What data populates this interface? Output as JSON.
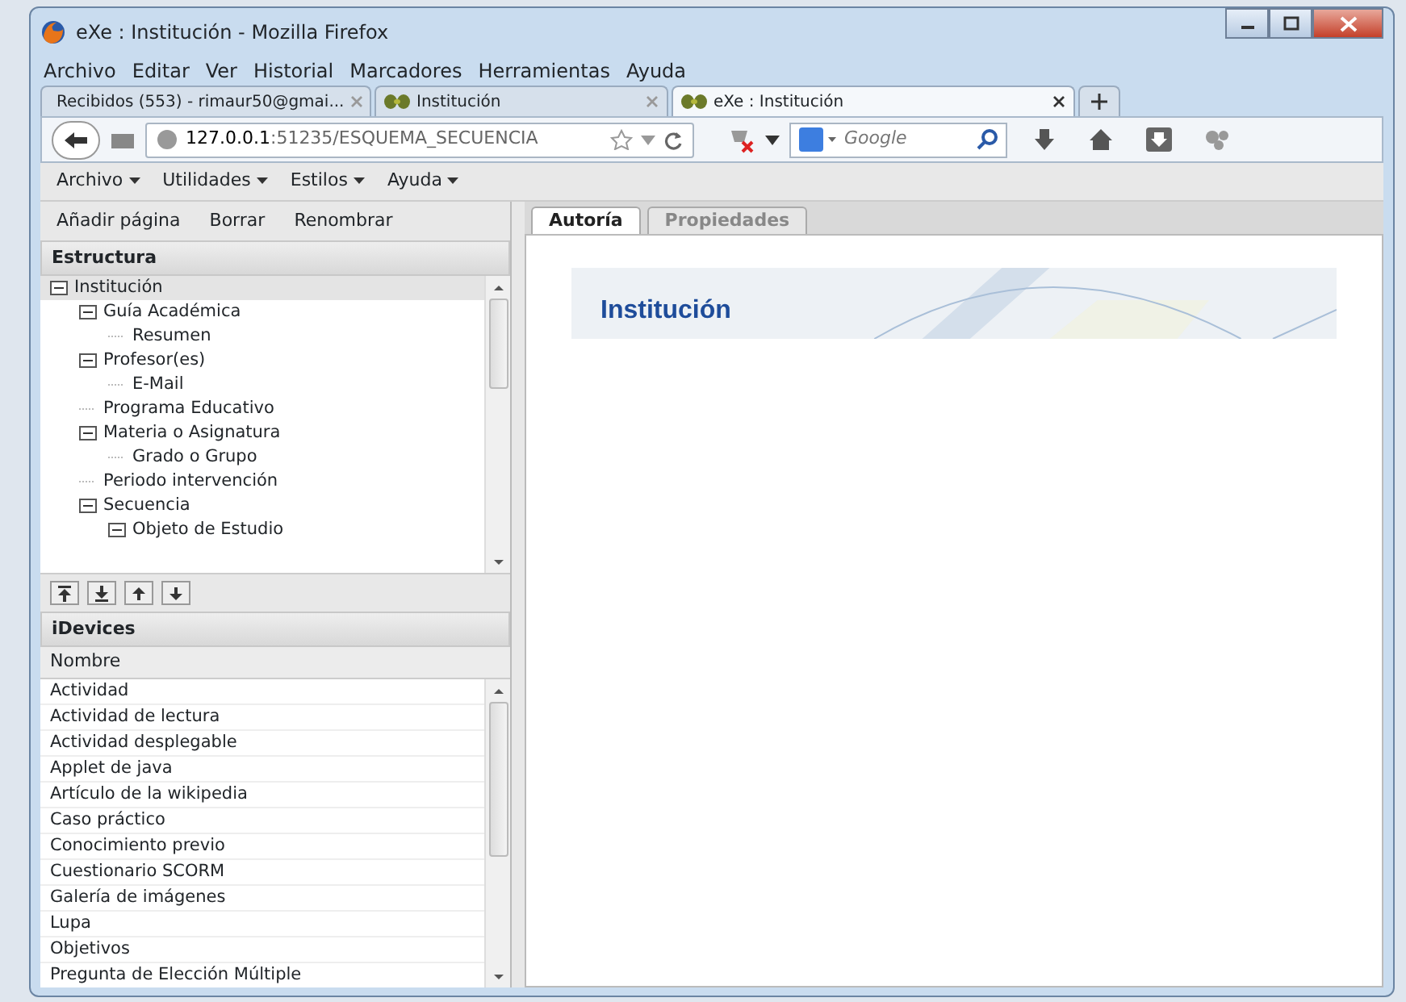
{
  "window": {
    "title": "eXe : Institución - Mozilla Firefox"
  },
  "browser_menu": [
    "Archivo",
    "Editar",
    "Ver",
    "Historial",
    "Marcadores",
    "Herramientas",
    "Ayuda"
  ],
  "browser_tabs": [
    {
      "label": "Recibidos (553) - rimaur50@gmai...",
      "kind": "mail",
      "selected": false
    },
    {
      "label": "Institución",
      "kind": "exe",
      "selected": false
    },
    {
      "label": "eXe : Institución",
      "kind": "exe",
      "selected": true
    }
  ],
  "address_bar": {
    "host": "127.0.0.1",
    "rest": ":51235/ESQUEMA_SECUENCIA"
  },
  "search": {
    "placeholder": "Google"
  },
  "app_menu": [
    "Archivo",
    "Utilidades",
    "Estilos",
    "Ayuda"
  ],
  "outline_toolbar": [
    "Añadir página",
    "Borrar",
    "Renombrar"
  ],
  "structure": {
    "title": "Estructura",
    "tree": [
      {
        "label": "Institución",
        "expanded": true,
        "selected": true,
        "children": [
          {
            "label": "Guía Académica",
            "expanded": true,
            "selected": false,
            "children": [
              {
                "label": "Resumen",
                "selected": false
              }
            ]
          },
          {
            "label": "Profesor(es)",
            "expanded": true,
            "selected": false,
            "children": [
              {
                "label": "E-Mail",
                "selected": false
              }
            ]
          },
          {
            "label": "Programa Educativo",
            "selected": false
          },
          {
            "label": "Materia o Asignatura",
            "expanded": true,
            "selected": false,
            "children": [
              {
                "label": "Grado o Grupo",
                "selected": false
              }
            ]
          },
          {
            "label": "Periodo intervención",
            "selected": false
          },
          {
            "label": "Secuencia",
            "expanded": true,
            "selected": false,
            "children": [
              {
                "label": "Objeto de Estudio",
                "expanded": true,
                "selected": false
              }
            ]
          }
        ]
      }
    ]
  },
  "idevices": {
    "title": "iDevices",
    "column": "Nombre",
    "items": [
      "Actividad",
      "Actividad de lectura",
      "Actividad desplegable",
      "Applet de java",
      "Artículo de la wikipedia",
      "Caso práctico",
      "Conocimiento previo",
      "Cuestionario SCORM",
      "Galería de imágenes",
      "Lupa",
      "Objetivos",
      "Pregunta de Elección Múltiple"
    ]
  },
  "editor_tabs": [
    {
      "label": "Autoría",
      "selected": true
    },
    {
      "label": "Propiedades",
      "selected": false
    }
  ],
  "page_title": "Institución"
}
